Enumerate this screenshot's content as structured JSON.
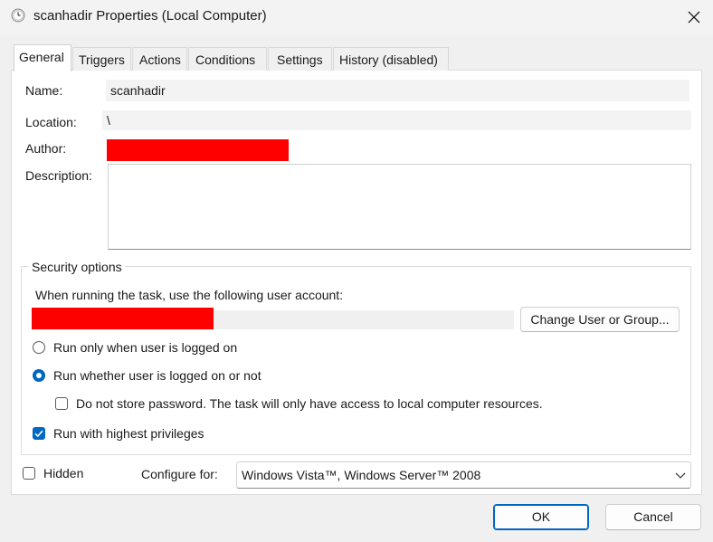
{
  "window": {
    "title": "scanhadir Properties (Local Computer)"
  },
  "tabs": [
    {
      "label": "General",
      "active": true
    },
    {
      "label": "Triggers",
      "active": false
    },
    {
      "label": "Actions",
      "active": false
    },
    {
      "label": "Conditions",
      "active": false
    },
    {
      "label": "Settings",
      "active": false
    },
    {
      "label": "History (disabled)",
      "active": false
    }
  ],
  "general": {
    "name_label": "Name:",
    "name_value": "scanhadir",
    "location_label": "Location:",
    "location_value": "\\",
    "author_label": "Author:",
    "description_label": "Description:",
    "description_value": ""
  },
  "security": {
    "group_title": "Security options",
    "account_prompt": "When running the task, use the following user account:",
    "change_button": "Change User or Group...",
    "radio_logged_on": "Run only when user is logged on",
    "radio_whether": "Run whether user is logged on or not",
    "selected_radio": "whether",
    "no_store_password": "Do not store password.  The task will only have access to local computer resources.",
    "no_store_password_checked": false,
    "highest_privileges": "Run with highest privileges",
    "highest_privileges_checked": true
  },
  "footer": {
    "hidden_label": "Hidden",
    "hidden_checked": false,
    "configure_label": "Configure for:",
    "configure_value": "Windows Vista™, Windows Server™ 2008",
    "ok_button": "OK",
    "cancel_button": "Cancel"
  },
  "colors": {
    "accent": "#0067c0",
    "redaction": "#ff0000"
  }
}
